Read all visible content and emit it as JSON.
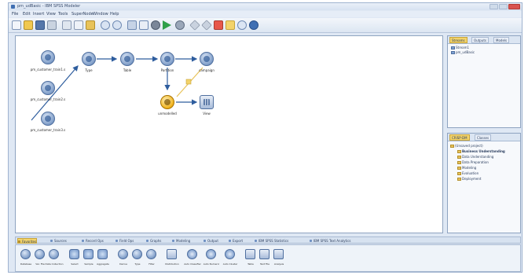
{
  "window": {
    "title": "pm_udBasic - IBM SPSS Modeler"
  },
  "menu": [
    "File",
    "Edit",
    "Insert",
    "View",
    "Tools",
    "SuperNode",
    "Window",
    "Help"
  ],
  "toolbar_icons": [
    "new-stream-icon",
    "open-icon",
    "save-icon",
    "print-icon",
    "cut-icon",
    "copy-icon",
    "paste-icon",
    "undo-icon",
    "redo-icon",
    "find-icon",
    "preview-icon",
    "stop-icon",
    "run-icon",
    "run-selection-icon",
    "favorite-icon",
    "favorite-2-icon",
    "insert-supernode-icon",
    "zoom-in-icon",
    "zoom-out-icon",
    "help-icon"
  ],
  "canvas": {
    "nodes": [
      {
        "id": "src1",
        "label": "pm_customer_train1.s"
      },
      {
        "id": "src2",
        "label": "pm_customer_train2.s"
      },
      {
        "id": "src3",
        "label": "pm_customer_train3.s"
      },
      {
        "id": "type",
        "label": "Type"
      },
      {
        "id": "table",
        "label": "Table"
      },
      {
        "id": "partition",
        "label": "Partition"
      },
      {
        "id": "campaign",
        "label": "campaign"
      },
      {
        "id": "unmodelled",
        "label": "unmodelled"
      },
      {
        "id": "view",
        "label": "View"
      }
    ]
  },
  "right_top": {
    "tabs": [
      "Streams",
      "Outputs",
      "Models"
    ],
    "items": [
      "Stream1",
      "pm_udBasic"
    ]
  },
  "right_bottom": {
    "tabs": [
      "CRISP-DM",
      "Classes"
    ],
    "root": "(Unsaved project)",
    "items": [
      "Business Understanding",
      "Data Understanding",
      "Data Preparation",
      "Modeling",
      "Evaluation",
      "Deployment"
    ]
  },
  "palette": {
    "tabs": [
      "Favorites",
      "Sources",
      "Record Ops",
      "Field Ops",
      "Graphs",
      "Modeling",
      "Output",
      "Export",
      "IBM SPSS Statistics",
      "IBM SPSS Text Analytics"
    ],
    "nodes": [
      "Database",
      "Var. File",
      "Data Collection",
      "Select",
      "Sample",
      "Aggregate",
      "Derive",
      "Type",
      "Filter",
      "Distribution",
      "Auto Classifier",
      "Auto Numeric",
      "Auto Cluster",
      "Table",
      "Text File",
      "Analysis"
    ]
  }
}
